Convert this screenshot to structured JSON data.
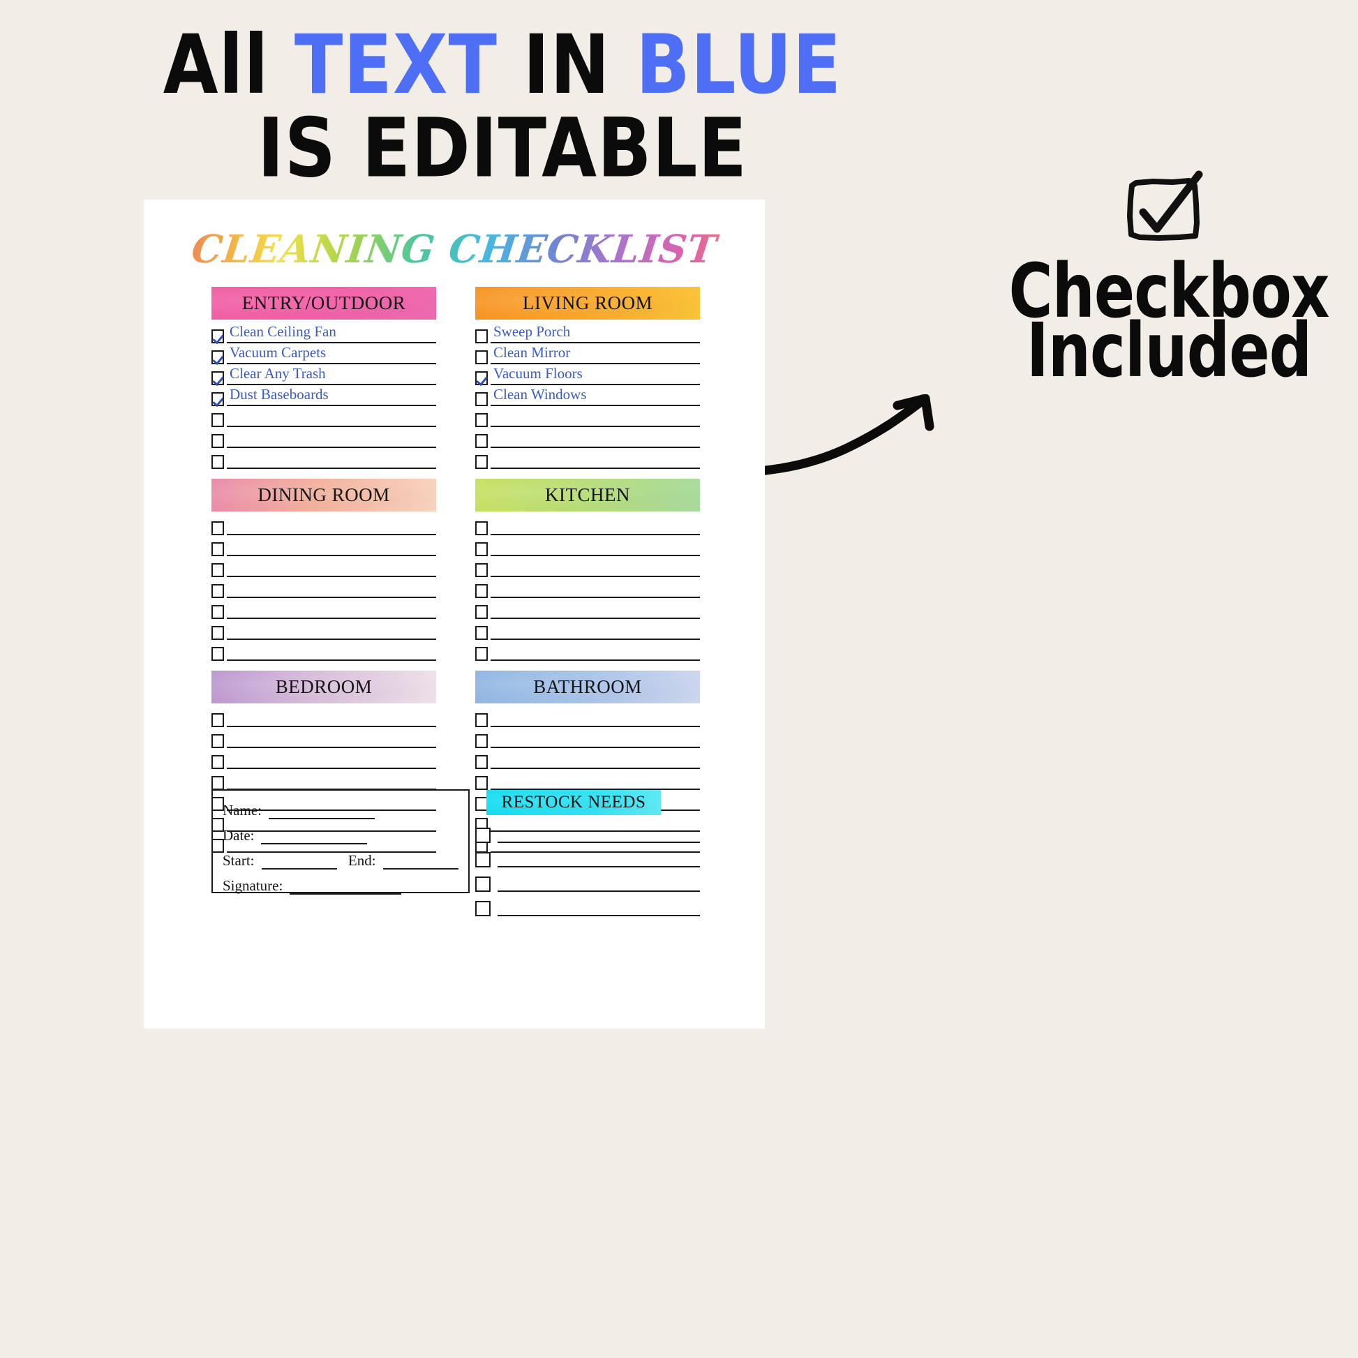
{
  "promo": {
    "line1_a": "All ",
    "line1_b": "TEXT",
    "line1_c": " IN ",
    "line1_d": "BLUE",
    "line2": "IS EDITABLE",
    "blue_hex": "#4d6ef5",
    "black_hex": "#0b0b0b"
  },
  "callout": {
    "icon": "checked-checkbox-icon",
    "line1": "Checkbox",
    "line2": "Included",
    "arrow": "curved-arrow-icon"
  },
  "sheet": {
    "title": "CLEANING CHECKLIST",
    "background_hex": "#ffffff",
    "editable_text_hex": "#3a5bbf"
  },
  "sections": [
    {
      "id": "entry-outdoor",
      "title": "ENTRY/OUTDOOR",
      "band_hex": "#f05fa4",
      "column": "left",
      "rows": [
        {
          "label": "Clean Ceiling Fan",
          "checked": true
        },
        {
          "label": "Vacuum Carpets",
          "checked": true
        },
        {
          "label": "Clear Any Trash",
          "checked": true
        },
        {
          "label": "Dust Baseboards",
          "checked": true
        },
        {
          "label": "",
          "checked": false
        },
        {
          "label": "",
          "checked": false
        },
        {
          "label": "",
          "checked": false
        }
      ]
    },
    {
      "id": "living-room",
      "title": "LIVING ROOM",
      "band_hex": "#f9a62b",
      "column": "right",
      "rows": [
        {
          "label": "Sweep Porch",
          "checked": false
        },
        {
          "label": "Clean Mirror",
          "checked": false
        },
        {
          "label": "Vacuum Floors",
          "checked": true
        },
        {
          "label": "Clean Windows",
          "checked": false
        },
        {
          "label": "",
          "checked": false
        },
        {
          "label": "",
          "checked": false
        },
        {
          "label": "",
          "checked": false
        }
      ]
    },
    {
      "id": "dining-room",
      "title": "DINING ROOM",
      "band_hex": "#f2b19c",
      "column": "left",
      "rows": [
        {
          "label": "",
          "checked": false
        },
        {
          "label": "",
          "checked": false
        },
        {
          "label": "",
          "checked": false
        },
        {
          "label": "",
          "checked": false
        },
        {
          "label": "",
          "checked": false
        },
        {
          "label": "",
          "checked": false
        },
        {
          "label": "",
          "checked": false
        }
      ]
    },
    {
      "id": "kitchen",
      "title": "KITCHEN",
      "band_hex": "#b7dd7b",
      "column": "right",
      "rows": [
        {
          "label": "",
          "checked": false
        },
        {
          "label": "",
          "checked": false
        },
        {
          "label": "",
          "checked": false
        },
        {
          "label": "",
          "checked": false
        },
        {
          "label": "",
          "checked": false
        },
        {
          "label": "",
          "checked": false
        },
        {
          "label": "",
          "checked": false
        }
      ]
    },
    {
      "id": "bedroom",
      "title": "BEDROOM",
      "band_hex": "#d7bdda",
      "column": "left",
      "rows": [
        {
          "label": "",
          "checked": false
        },
        {
          "label": "",
          "checked": false
        },
        {
          "label": "",
          "checked": false
        },
        {
          "label": "",
          "checked": false
        },
        {
          "label": "",
          "checked": false
        },
        {
          "label": "",
          "checked": false
        },
        {
          "label": "",
          "checked": false
        }
      ]
    },
    {
      "id": "bathroom",
      "title": "BATHROOM",
      "band_hex": "#a9c3e8",
      "column": "right",
      "rows": [
        {
          "label": "",
          "checked": false
        },
        {
          "label": "",
          "checked": false
        },
        {
          "label": "",
          "checked": false
        },
        {
          "label": "",
          "checked": false
        },
        {
          "label": "",
          "checked": false
        },
        {
          "label": "",
          "checked": false
        },
        {
          "label": "",
          "checked": false
        }
      ]
    }
  ],
  "info_box": {
    "name_label": "Name:",
    "name_value": "",
    "date_label": "Date:",
    "date_value": "",
    "start_label": "Start:",
    "start_value": "",
    "end_label": "End:",
    "end_value": "",
    "signature_label": "Signature:",
    "signature_value": ""
  },
  "restock": {
    "title": "RESTOCK NEEDS",
    "band_hex": "#32e2f2",
    "rows": [
      {
        "label": "",
        "checked": false
      },
      {
        "label": "",
        "checked": false
      },
      {
        "label": "",
        "checked": false
      },
      {
        "label": "",
        "checked": false
      }
    ]
  }
}
